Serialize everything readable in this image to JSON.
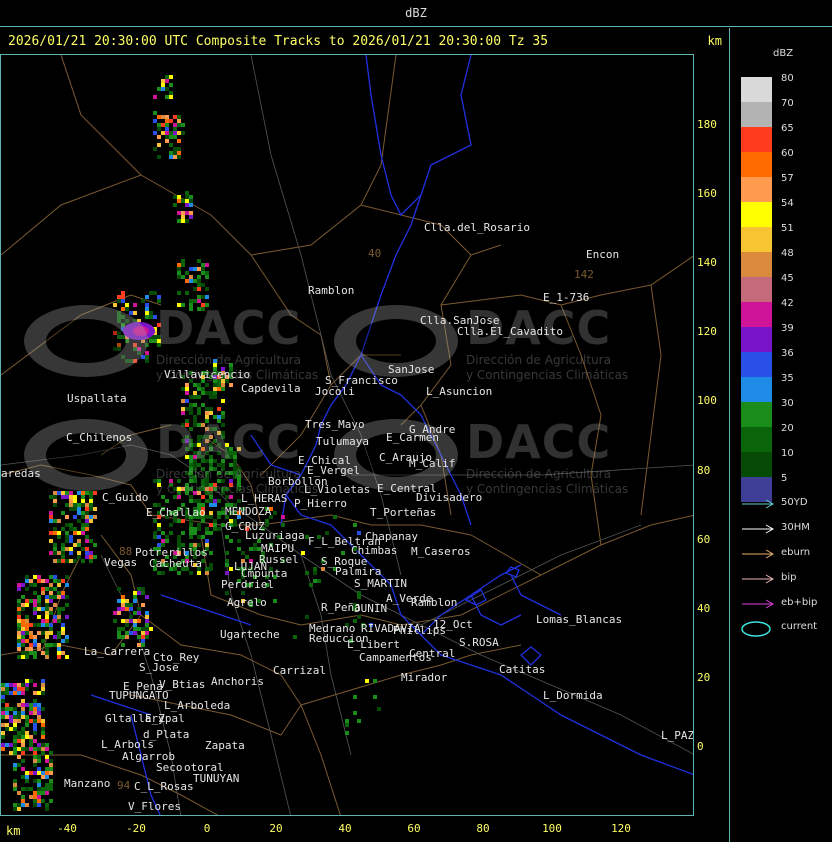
{
  "header": {
    "title": "dBZ"
  },
  "product": {
    "title": "2026/01/21 20:30:00 UTC Composite Tracks to 2026/01/21 20:30:00 Tz 35",
    "y_unit": "km",
    "x_unit": "km"
  },
  "axes": {
    "y_ticks": [
      "180",
      "160",
      "140",
      "120",
      "100",
      "80",
      "60",
      "40",
      "20",
      "0"
    ],
    "x_ticks": [
      "-40",
      "-20",
      "0",
      "20",
      "40",
      "60",
      "80",
      "100",
      "120"
    ]
  },
  "legend": {
    "title": "dBZ",
    "levels": [
      {
        "label": "80",
        "color": "#d9d9d9"
      },
      {
        "label": "70",
        "color": "#b3b3b3"
      },
      {
        "label": "65",
        "color": "#ff3c1e"
      },
      {
        "label": "60",
        "color": "#ff6a00"
      },
      {
        "label": "57",
        "color": "#ff9a4e"
      },
      {
        "label": "54",
        "color": "#ffff00"
      },
      {
        "label": "51",
        "color": "#f7c531"
      },
      {
        "label": "48",
        "color": "#d98a3c"
      },
      {
        "label": "45",
        "color": "#c46a7a"
      },
      {
        "label": "42",
        "color": "#d0149a"
      },
      {
        "label": "39",
        "color": "#7a14c8"
      },
      {
        "label": "36",
        "color": "#2850e6"
      },
      {
        "label": "35",
        "color": "#1e8ce6"
      },
      {
        "label": "30",
        "color": "#1a8c1a"
      },
      {
        "label": "20",
        "color": "#0a640a"
      },
      {
        "label": "10",
        "color": "#054a05"
      },
      {
        "label": "5",
        "color": "#3e3e96"
      }
    ]
  },
  "tracks": [
    {
      "label": "50YD",
      "color": "#5fd0d0"
    },
    {
      "label": "30HM",
      "color": "#ffffff"
    },
    {
      "label": "eburn",
      "color": "#e8b070"
    },
    {
      "label": "bip",
      "color": "#f0b8b8"
    },
    {
      "label": "eb+bip",
      "color": "#e040e0"
    },
    {
      "label": "current",
      "color": "#40e0e0"
    }
  ],
  "watermark": {
    "name": "DACC",
    "line1": "Dirección de Agricultura",
    "line2": "y Contingencias Climáticas"
  },
  "places": [
    {
      "name": "Clla.del_Rosario"
    },
    {
      "name": "Encon"
    },
    {
      "name": "142"
    },
    {
      "name": "E_1-736"
    },
    {
      "name": "Ramblon"
    },
    {
      "name": "Clla.SanJose"
    },
    {
      "name": "Clla.El_Cavadito"
    },
    {
      "name": "Villavicencio"
    },
    {
      "name": "Capdevila"
    },
    {
      "name": "S_Francisco"
    },
    {
      "name": "SanJose"
    },
    {
      "name": "Jocoli"
    },
    {
      "name": "L_Asuncion"
    },
    {
      "name": "Uspallata"
    },
    {
      "name": "Tres_Mayo"
    },
    {
      "name": "G_Andre"
    },
    {
      "name": "C_Chilenos"
    },
    {
      "name": "Tulumaya"
    },
    {
      "name": "E_Carmen"
    },
    {
      "name": "E_Chical"
    },
    {
      "name": "C_Araujo"
    },
    {
      "name": "M_Calif"
    },
    {
      "name": "aredas"
    },
    {
      "name": "E_Vergel"
    },
    {
      "name": "Borbollon"
    },
    {
      "name": "L_Violetas"
    },
    {
      "name": "E_Central"
    },
    {
      "name": "Divisadero"
    },
    {
      "name": "C_Guido"
    },
    {
      "name": "L_HERAS"
    },
    {
      "name": "P_Hierro"
    },
    {
      "name": "E_Challao"
    },
    {
      "name": "MENDOZA"
    },
    {
      "name": "T_Porteñas"
    },
    {
      "name": "G_CRUZ"
    },
    {
      "name": "Luzuriaga"
    },
    {
      "name": "Chapanay"
    },
    {
      "name": "F_L_Beltran"
    },
    {
      "name": "MAIPU"
    },
    {
      "name": "Chimbas"
    },
    {
      "name": "M_Caseros"
    },
    {
      "name": "Potrerillos"
    },
    {
      "name": "Russel"
    },
    {
      "name": "Vegas"
    },
    {
      "name": "Cacheuta"
    },
    {
      "name": "S_Roque"
    },
    {
      "name": "LUJAN"
    },
    {
      "name": "Palmira"
    },
    {
      "name": "Cmpunta"
    },
    {
      "name": "S_MARTIN"
    },
    {
      "name": "Perdriel"
    },
    {
      "name": "A_Verde"
    },
    {
      "name": "Ramblon"
    },
    {
      "name": "Agrelo"
    },
    {
      "name": "R_Peña"
    },
    {
      "name": "JUNIN"
    },
    {
      "name": "Lomas_Blancas"
    },
    {
      "name": "Ugarteche"
    },
    {
      "name": "Medrano"
    },
    {
      "name": "RIVADAVIA"
    },
    {
      "name": "Phillips"
    },
    {
      "name": "12_Oct"
    },
    {
      "name": "Reduccion"
    },
    {
      "name": "S.ROSA"
    },
    {
      "name": "La_Carrera"
    },
    {
      "name": "L_Libert"
    },
    {
      "name": "Cto_Rey"
    },
    {
      "name": "Campamentos"
    },
    {
      "name": "Central"
    },
    {
      "name": "S_Jose"
    },
    {
      "name": "Carrizal"
    },
    {
      "name": "Catitas"
    },
    {
      "name": "Anchoris"
    },
    {
      "name": "Mirador"
    },
    {
      "name": "E_Pena"
    },
    {
      "name": "V_Btias"
    },
    {
      "name": "TUPUNGATO"
    },
    {
      "name": "L_Dormida"
    },
    {
      "name": "L_Arboleda"
    },
    {
      "name": "Gltallary"
    },
    {
      "name": "E_Zpal"
    },
    {
      "name": "d_Plata"
    },
    {
      "name": "L_PAZ"
    },
    {
      "name": "L_Arbols"
    },
    {
      "name": "Zapata"
    },
    {
      "name": "Algarrob"
    },
    {
      "name": "Seco"
    },
    {
      "name": "otoral"
    },
    {
      "name": "TUNUYAN"
    },
    {
      "name": "Manzano"
    },
    {
      "name": "94"
    },
    {
      "name": "C_L_Rosas"
    },
    {
      "name": "V_Flores"
    },
    {
      "name": "40"
    },
    {
      "name": "88"
    }
  ]
}
